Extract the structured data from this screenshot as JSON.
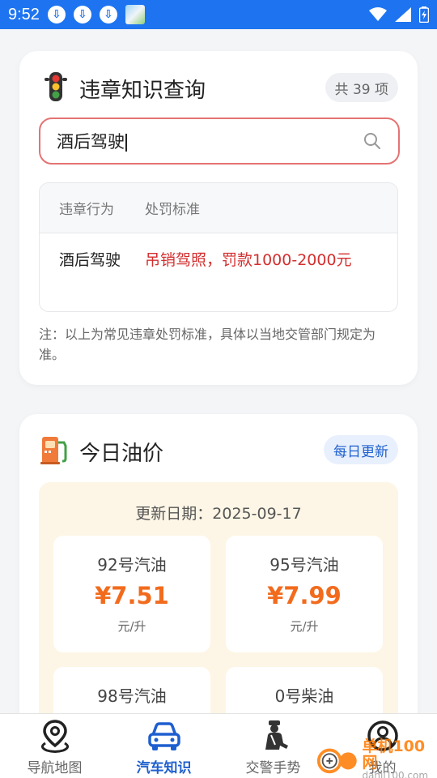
{
  "status_bar": {
    "time": "9:52"
  },
  "violation": {
    "title": "违章知识查询",
    "count": "共 39 项",
    "search_value": "酒后驾驶",
    "columns": [
      "违章行为",
      "处罚标准"
    ],
    "rows": [
      {
        "behavior": "酒后驾驶",
        "penalty": "吊销驾照，罚款1000-2000元"
      }
    ],
    "note": "注：以上为常见违章处罚标准，具体以当地交管部门规定为准。"
  },
  "oil": {
    "title": "今日油价",
    "badge": "每日更新",
    "date_label": "更新日期：2025-09-17",
    "prices": [
      {
        "name": "92号汽油",
        "price": "¥7.51",
        "unit": "元/升"
      },
      {
        "name": "95号汽油",
        "price": "¥7.99",
        "unit": "元/升"
      },
      {
        "name": "98号汽油"
      },
      {
        "name": "0号柴油"
      }
    ]
  },
  "nav": {
    "items": [
      {
        "label": "导航地图",
        "icon": "map-pin-icon"
      },
      {
        "label": "汽车知识",
        "icon": "car-icon",
        "active": true
      },
      {
        "label": "交警手势",
        "icon": "police-icon"
      },
      {
        "label": "我的",
        "icon": "user-icon"
      }
    ]
  },
  "watermark": {
    "text": "单机100网",
    "sub": "danji100.com"
  },
  "colors": {
    "accent": "#1e74f0",
    "penalty": "#d32f2f",
    "price": "#f26b1d"
  }
}
